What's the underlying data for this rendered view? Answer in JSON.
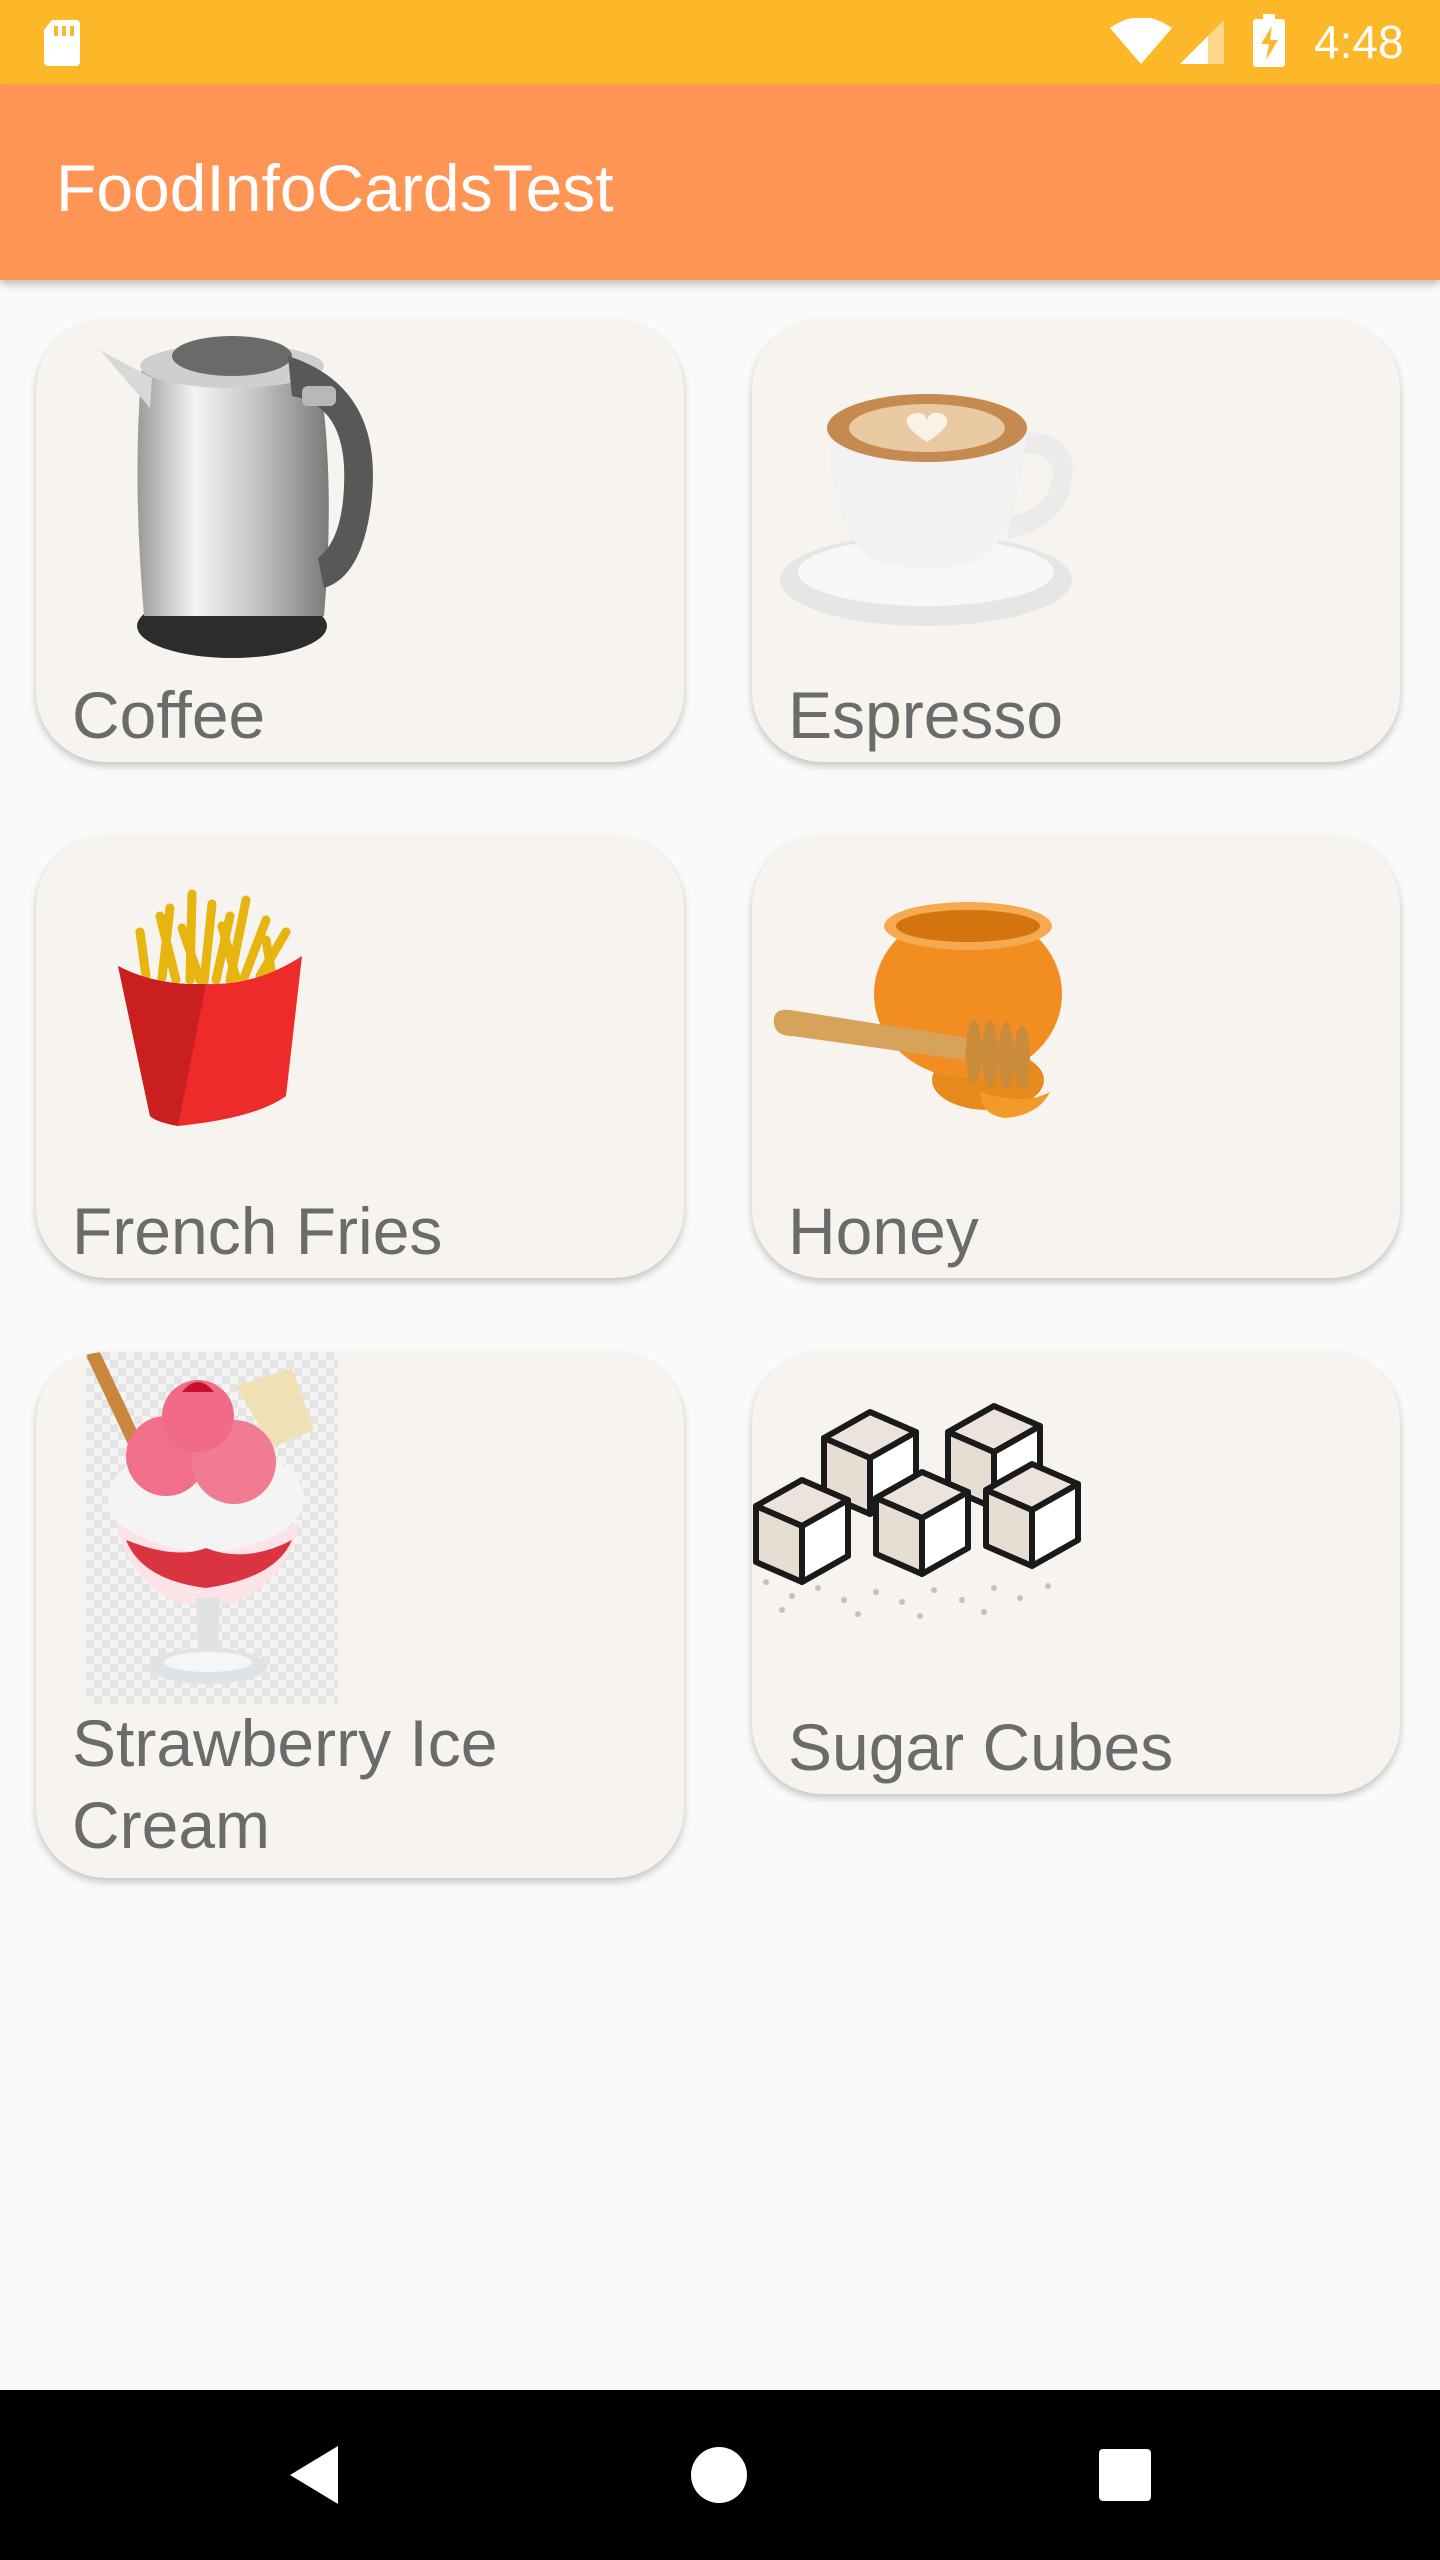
{
  "status_bar": {
    "time": "4:48",
    "icons": [
      "sd-card-icon",
      "wifi-icon",
      "cell-signal-icon",
      "battery-charging-icon"
    ]
  },
  "app_bar": {
    "title": "FoodInfoCardsTest"
  },
  "cards": [
    {
      "label": "Coffee",
      "image": "kettle-image"
    },
    {
      "label": "Espresso",
      "image": "espresso-cup-image"
    },
    {
      "label": "French Fries",
      "image": "french-fries-image"
    },
    {
      "label": "Honey",
      "image": "honey-jar-image"
    },
    {
      "label": "Strawberry Ice Cream",
      "image": "strawberry-ice-cream-image"
    },
    {
      "label": "Sugar Cubes",
      "image": "sugar-cubes-image"
    }
  ],
  "nav_bar": {
    "icons": [
      "back-icon",
      "home-icon",
      "recent-apps-icon"
    ]
  },
  "colors": {
    "status_bar": "#fdb82a",
    "app_bar": "#ff9554",
    "card_background": "#f7f3ee",
    "label_text": "#6b6b6b",
    "page_background": "#fafafa"
  }
}
